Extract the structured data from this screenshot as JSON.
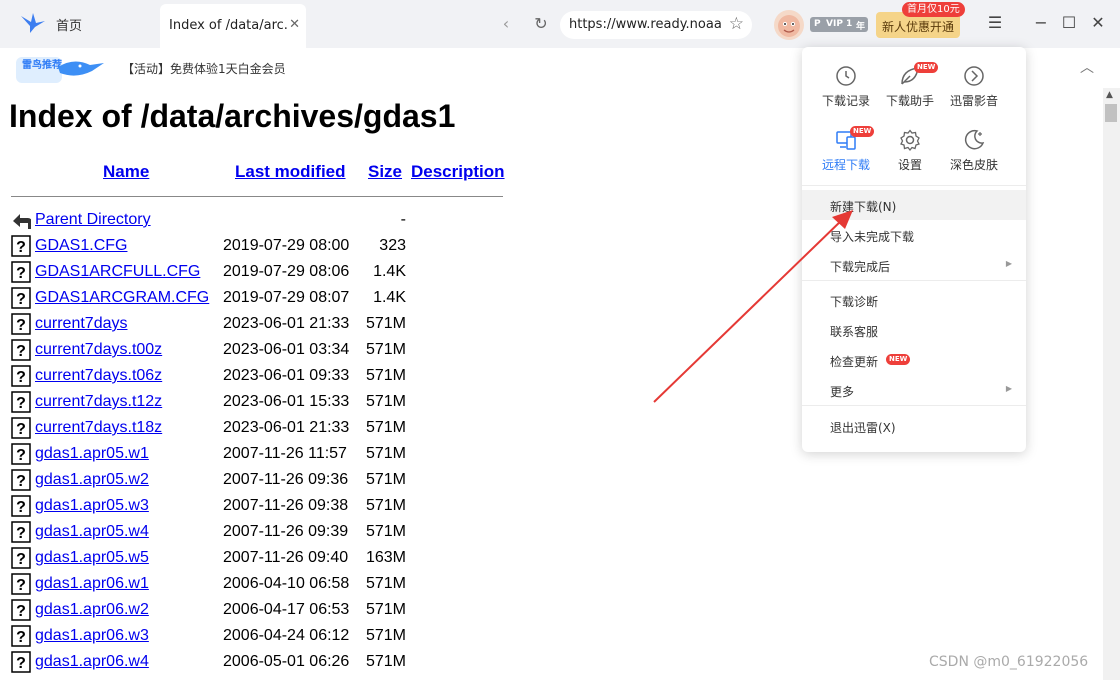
{
  "browser": {
    "home_tab": "首页",
    "active_tab_title": "Index of /data/arc...",
    "url": "https://www.ready.noaa.g",
    "vip_letter": "P",
    "vip_level": "VIP 1",
    "vip_year": "年",
    "promo_button": "新人优惠开通",
    "promo_tag": "首月仅10元"
  },
  "banner": {
    "text": "【活动】免费体验1天白金会员",
    "logo_text": "雷鸟推荐"
  },
  "page": {
    "heading": "Index of /data/archives/gdas1",
    "columns": {
      "name": "Name",
      "last_modified": "Last modified",
      "size": "Size",
      "description": "Description"
    },
    "rows": [
      {
        "name": "Parent Directory",
        "date": "",
        "size": "-",
        "kind": "parent"
      },
      {
        "name": "GDAS1.CFG",
        "date": "2019-07-29 08:00",
        "size": "323",
        "kind": "file"
      },
      {
        "name": "GDAS1ARCFULL.CFG",
        "date": "2019-07-29 08:06",
        "size": "1.4K",
        "kind": "file"
      },
      {
        "name": "GDAS1ARCGRAM.CFG",
        "date": "2019-07-29 08:07",
        "size": "1.4K",
        "kind": "file"
      },
      {
        "name": "current7days",
        "date": "2023-06-01 21:33",
        "size": "571M",
        "kind": "file"
      },
      {
        "name": "current7days.t00z",
        "date": "2023-06-01 03:34",
        "size": "571M",
        "kind": "file"
      },
      {
        "name": "current7days.t06z",
        "date": "2023-06-01 09:33",
        "size": "571M",
        "kind": "file"
      },
      {
        "name": "current7days.t12z",
        "date": "2023-06-01 15:33",
        "size": "571M",
        "kind": "file"
      },
      {
        "name": "current7days.t18z",
        "date": "2023-06-01 21:33",
        "size": "571M",
        "kind": "file"
      },
      {
        "name": "gdas1.apr05.w1",
        "date": "2007-11-26 11:57",
        "size": "571M",
        "kind": "file"
      },
      {
        "name": "gdas1.apr05.w2",
        "date": "2007-11-26 09:36",
        "size": "571M",
        "kind": "file"
      },
      {
        "name": "gdas1.apr05.w3",
        "date": "2007-11-26 09:38",
        "size": "571M",
        "kind": "file"
      },
      {
        "name": "gdas1.apr05.w4",
        "date": "2007-11-26 09:39",
        "size": "571M",
        "kind": "file"
      },
      {
        "name": "gdas1.apr05.w5",
        "date": "2007-11-26 09:40",
        "size": "163M",
        "kind": "file"
      },
      {
        "name": "gdas1.apr06.w1",
        "date": "2006-04-10 06:58",
        "size": "571M",
        "kind": "file"
      },
      {
        "name": "gdas1.apr06.w2",
        "date": "2006-04-17 06:53",
        "size": "571M",
        "kind": "file"
      },
      {
        "name": "gdas1.apr06.w3",
        "date": "2006-04-24 06:12",
        "size": "571M",
        "kind": "file"
      },
      {
        "name": "gdas1.apr06.w4",
        "date": "2006-05-01 06:26",
        "size": "571M",
        "kind": "file"
      }
    ]
  },
  "menu": {
    "quick": [
      {
        "label": "下载记录",
        "icon": "history-icon",
        "new": false,
        "active": false
      },
      {
        "label": "下载助手",
        "icon": "leaf-icon",
        "new": true,
        "active": false
      },
      {
        "label": "迅雷影音",
        "icon": "player-icon",
        "new": false,
        "active": false
      },
      {
        "label": "远程下载",
        "icon": "remote-device-icon",
        "new": true,
        "active": true
      },
      {
        "label": "设置",
        "icon": "gear-icon",
        "new": false,
        "active": false
      },
      {
        "label": "深色皮肤",
        "icon": "moon-icon",
        "new": false,
        "active": false
      }
    ],
    "new_tag": "NEW",
    "items": [
      {
        "label": "新建下载(N)",
        "submenu": false,
        "new": false,
        "highlighted": true
      },
      {
        "label": "导入未完成下载",
        "submenu": false,
        "new": false,
        "highlighted": false
      },
      {
        "label": "下载完成后",
        "submenu": true,
        "new": false,
        "highlighted": false
      },
      {
        "label": "下载诊断",
        "submenu": false,
        "new": false,
        "highlighted": false
      },
      {
        "label": "联系客服",
        "submenu": false,
        "new": false,
        "highlighted": false
      },
      {
        "label": "检查更新",
        "submenu": false,
        "new": true,
        "highlighted": false
      },
      {
        "label": "更多",
        "submenu": true,
        "new": false,
        "highlighted": false
      },
      {
        "label": "退出迅雷(X)",
        "submenu": false,
        "new": false,
        "highlighted": false
      }
    ]
  },
  "watermark": "CSDN @m0_61922056",
  "colors": {
    "link": "#0000ee",
    "accent": "#2f7cf6",
    "new_badge": "#ee3f3a",
    "promo": "#f5d489",
    "annotation": "#e53935"
  }
}
